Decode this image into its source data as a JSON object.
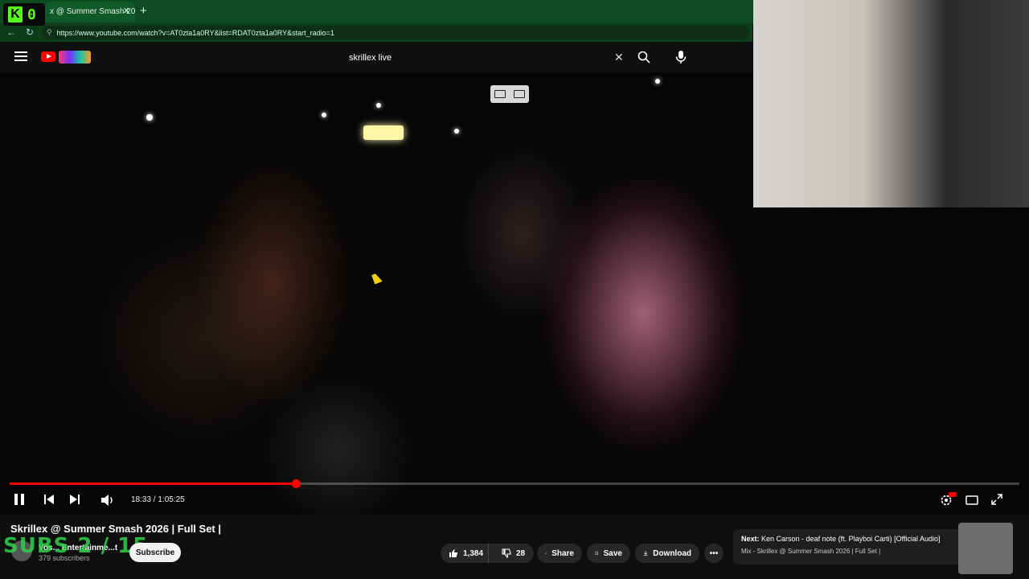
{
  "browser": {
    "kick_counter": "0",
    "tab_title": "x @ Summer Smash 20",
    "url": "https://www.youtube.com/watch?v=AT0zta1a0RY&list=RDAT0zta1a0RY&start_radio=1"
  },
  "search": {
    "query": "skrillex live"
  },
  "player": {
    "time_current": "18:33",
    "time_total": "1:05:25",
    "time_display": "18:33 / 1:05:25",
    "progress_fraction": 0.2835
  },
  "video": {
    "title": "Skrillex @ Summer Smash 2026 | Full Set |",
    "channel_name": "Lyrical Lemonade Entertainment",
    "channel_name_visible": "Vos... Entertainme...t",
    "subscribers": "379 subscribers",
    "subscribe_label": "Subscribe"
  },
  "overlay": {
    "subs_goal": "SUBS 2 / 15"
  },
  "actions": {
    "likes": "1,384",
    "dislikes": "28",
    "share_label": "Share",
    "save_label": "Save",
    "download_label": "Download"
  },
  "next_up": {
    "prefix": "Next:",
    "title": "Ken Carson - deaf note (ft. Playboi Carti) [Official Audio]",
    "mix": "Mix - Skrillex @ Summer Smash 2026 | Full Set |"
  },
  "colors": {
    "accent_red": "#ff0000",
    "kick_green": "#53fc18",
    "browser_green": "#0d4a1f"
  }
}
